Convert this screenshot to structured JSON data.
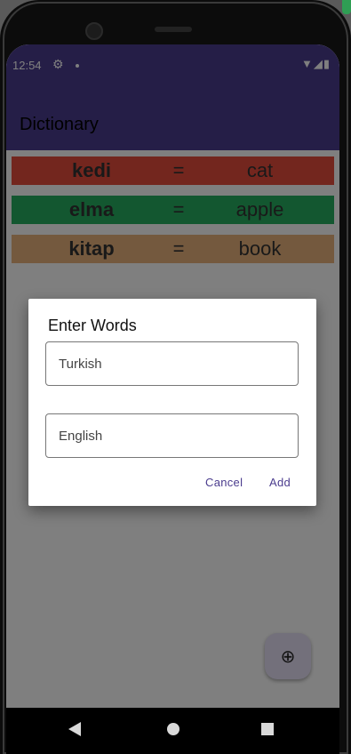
{
  "status_bar": {
    "time": "12:54"
  },
  "app_bar": {
    "title": "Dictionary"
  },
  "words": [
    {
      "turkish": "kedi",
      "separator": "=",
      "english": "cat",
      "color": "#e74c3c"
    },
    {
      "turkish": "elma",
      "separator": "=",
      "english": "apple",
      "color": "#27ae60"
    },
    {
      "turkish": "kitap",
      "separator": "=",
      "english": "book",
      "color": "#e8b27c"
    }
  ],
  "dialog": {
    "title": "Enter Words",
    "turkish_field": {
      "placeholder": "Turkish",
      "value": ""
    },
    "english_field": {
      "placeholder": "English",
      "value": ""
    },
    "cancel_label": "Cancel",
    "add_label": "Add"
  },
  "fab": {
    "icon": "add-circle-icon"
  },
  "nav": {
    "back_icon": "back-icon",
    "home_icon": "home-icon",
    "recent_icon": "recent-apps-icon"
  },
  "colors": {
    "primary": "#4b3c8e",
    "fab_bg": "#e6e0f6"
  }
}
